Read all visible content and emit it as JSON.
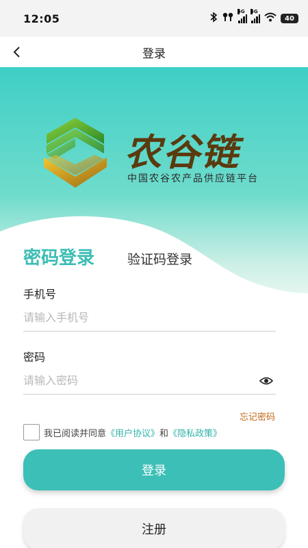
{
  "status_bar": {
    "time": "12:05",
    "network_tag_1": "5G",
    "network_tag_2": "5G",
    "battery": "40"
  },
  "nav": {
    "title": "登录",
    "back_icon": "chevron-left-icon"
  },
  "brand": {
    "name": "农谷链",
    "subtitle": "中国农谷农产品供应链平台",
    "logo_icon": "leaf-hexagon-logo",
    "colors": {
      "primary": "#3cbfb6",
      "brand_text": "#5a3a0e",
      "green": "#3e9a2a",
      "gold": "#c9951c"
    }
  },
  "tabs": {
    "password_login": "密码登录",
    "code_login": "验证码登录"
  },
  "form": {
    "phone_label": "手机号",
    "phone_placeholder": "请输入手机号",
    "password_label": "密码",
    "password_placeholder": "请输入密码",
    "forgot_password": "忘记密码",
    "eye_icon": "eye-icon"
  },
  "agreement": {
    "prefix": "我已阅读并同意",
    "user_agreement": "《用户协议》",
    "and": "和",
    "privacy_policy": "《隐私政策》",
    "checked": false
  },
  "buttons": {
    "login": "登录",
    "register": "注册"
  }
}
